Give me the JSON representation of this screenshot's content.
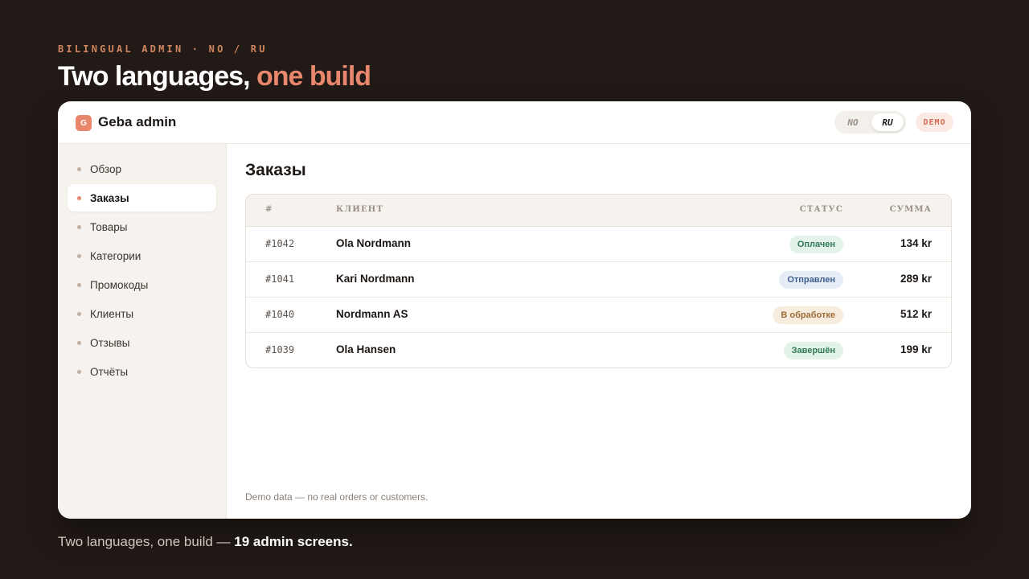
{
  "eyebrow": "BILINGUAL ADMIN · NO / RU",
  "hero": {
    "title_main": "Two languages,",
    "title_accent": "one build"
  },
  "app": {
    "logo_letter": "G",
    "name": "Geba admin",
    "languages": [
      "NO",
      "RU"
    ],
    "active_language": "RU",
    "demo_badge": "DEMO"
  },
  "sidebar": {
    "items": [
      {
        "label": "Обзор",
        "active": false
      },
      {
        "label": "Заказы",
        "active": true
      },
      {
        "label": "Товары",
        "active": false
      },
      {
        "label": "Категории",
        "active": false
      },
      {
        "label": "Промокоды",
        "active": false
      },
      {
        "label": "Клиенты",
        "active": false
      },
      {
        "label": "Отзывы",
        "active": false
      },
      {
        "label": "Отчёты",
        "active": false
      }
    ]
  },
  "main": {
    "title": "Заказы",
    "table": {
      "headers": {
        "number": "#",
        "client": "КЛИЕНТ",
        "status": "СТАТУС",
        "amount": "СУММА"
      },
      "rows": [
        {
          "number": "#1042",
          "client": "Ola Nordmann",
          "status": "Оплачен",
          "amount": "134 kr"
        },
        {
          "number": "#1041",
          "client": "Kari Nordmann",
          "status": "Отправлен",
          "amount": "289 kr"
        },
        {
          "number": "#1040",
          "client": "Nordmann AS",
          "status": "В обработке",
          "amount": "512 kr"
        },
        {
          "number": "#1039",
          "client": "Ola Hansen",
          "status": "Завершён",
          "amount": "199 kr"
        }
      ]
    },
    "footnote": "Demo data — no real orders or customers."
  },
  "caption": {
    "text": "Two languages, one build —",
    "emphasis": "19 admin screens."
  },
  "colors": {
    "accent": "#e8876c",
    "status_paid_bg": "#e3f3ea",
    "status_paid_fg": "#2f7a52",
    "status_shipped_bg": "#e6edf7",
    "status_shipped_fg": "#3d5f8f",
    "status_processing_bg": "#f8ecde",
    "status_processing_fg": "#9a6a36",
    "status_done_bg": "#e3f3ea",
    "status_done_fg": "#2f7a52"
  }
}
